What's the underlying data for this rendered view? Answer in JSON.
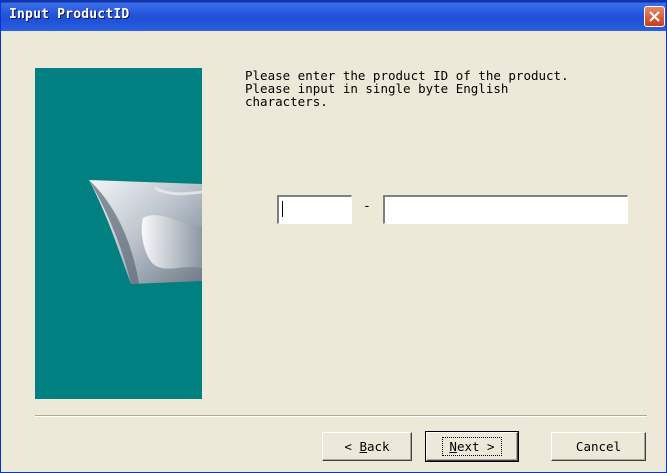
{
  "window": {
    "title": "Input ProductID"
  },
  "instructions": {
    "text": "Please enter the product ID of the product.\nPlease input in single byte English\ncharacters."
  },
  "product_id": {
    "part1_value": "",
    "separator": "-",
    "part2_value": ""
  },
  "buttons": {
    "back_prefix": "< ",
    "back_key": "B",
    "back_rest": "ack",
    "next_key": "N",
    "next_rest": "ext >",
    "cancel": "Cancel"
  },
  "colors": {
    "title_bar": "#2658DC",
    "art_panel": "#008080",
    "dialog_bg": "#ECE9D8",
    "close_button": "#D4562C"
  },
  "icons": {
    "close": "close-x-icon",
    "art": "product-wave-graphic"
  }
}
